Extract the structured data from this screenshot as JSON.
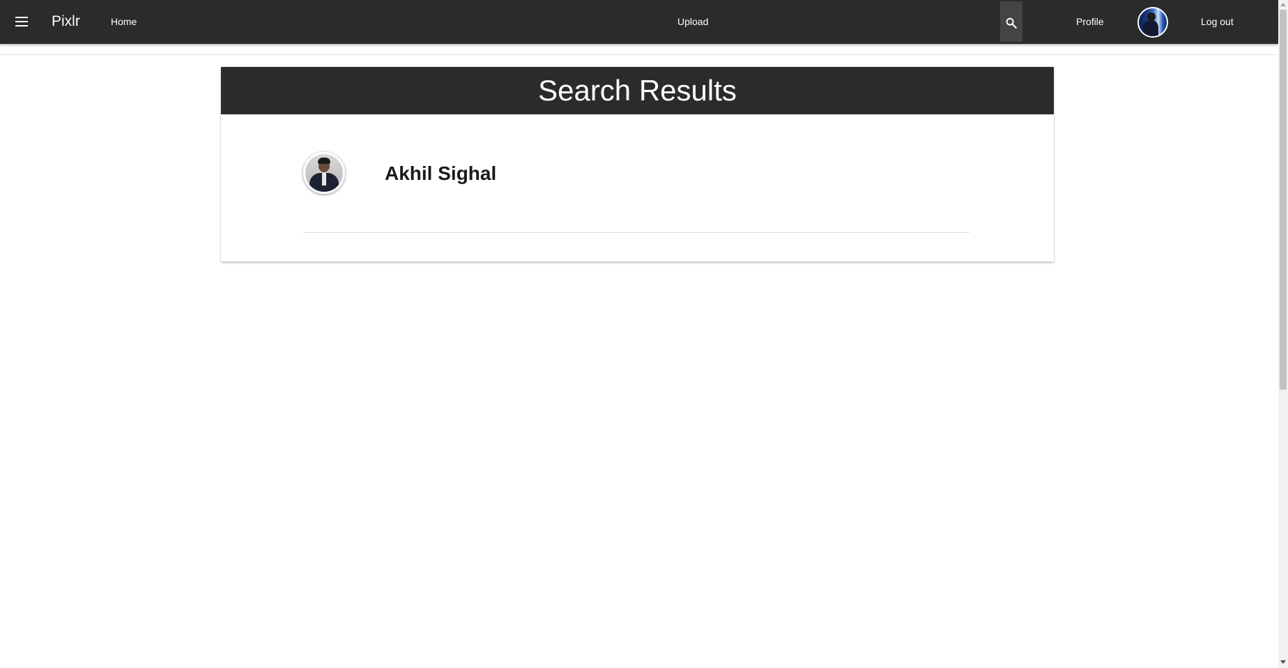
{
  "navbar": {
    "menu_icon": "hamburger-menu-icon",
    "brand": "Pixlr",
    "home_label": "Home",
    "upload_label": "Upload",
    "search_icon": "search-icon",
    "profile_label": "Profile",
    "logout_label": "Log out",
    "background_color": "#2b2b2b",
    "text_color": "#ffffff"
  },
  "search_results": {
    "title": "Search Results",
    "header_color": "#2b2b2b",
    "results": [
      {
        "name": "Akhil Sighal"
      }
    ]
  }
}
